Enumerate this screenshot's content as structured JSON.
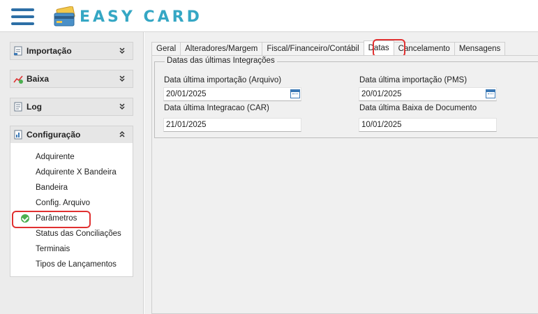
{
  "app": {
    "logo_text": "EASY CARD",
    "brand_color": "#35a7c4",
    "menu_icon": "hamburger-icon"
  },
  "sidebar": {
    "sections": [
      {
        "label": "Importação",
        "icon": "import-icon",
        "expanded": false
      },
      {
        "label": "Baixa",
        "icon": "chart-icon",
        "expanded": false
      },
      {
        "label": "Log",
        "icon": "document-icon",
        "expanded": false
      },
      {
        "label": "Configuração",
        "icon": "config-icon",
        "expanded": true
      }
    ],
    "config_items": [
      {
        "label": "Adquirente"
      },
      {
        "label": "Adquirente X Bandeira"
      },
      {
        "label": "Bandeira"
      },
      {
        "label": "Config. Arquivo"
      },
      {
        "label": "Parâmetros",
        "selected": true
      },
      {
        "label": "Status das Conciliações"
      },
      {
        "label": "Terminais"
      },
      {
        "label": "Tipos de Lançamentos"
      }
    ]
  },
  "tabs": [
    {
      "label": "Geral"
    },
    {
      "label": "Alteradores/Margem"
    },
    {
      "label": "Fiscal/Financeiro/Contábil"
    },
    {
      "label": "Datas",
      "active": true
    },
    {
      "label": "Cancelamento"
    },
    {
      "label": "Mensagens"
    }
  ],
  "datas": {
    "group_title": "Datas das últimas Integrações",
    "fields": [
      {
        "label": "Data última importação (Arquivo)",
        "value": "20/01/2025"
      },
      {
        "label": "Data última importação (PMS)",
        "value": "20/01/2025"
      },
      {
        "label": "Data última Integracao (CAR)",
        "value": "21/01/2025"
      },
      {
        "label": "Data última Baixa de Documento",
        "value": "10/01/2025"
      }
    ]
  },
  "highlight_color": "#e03030"
}
